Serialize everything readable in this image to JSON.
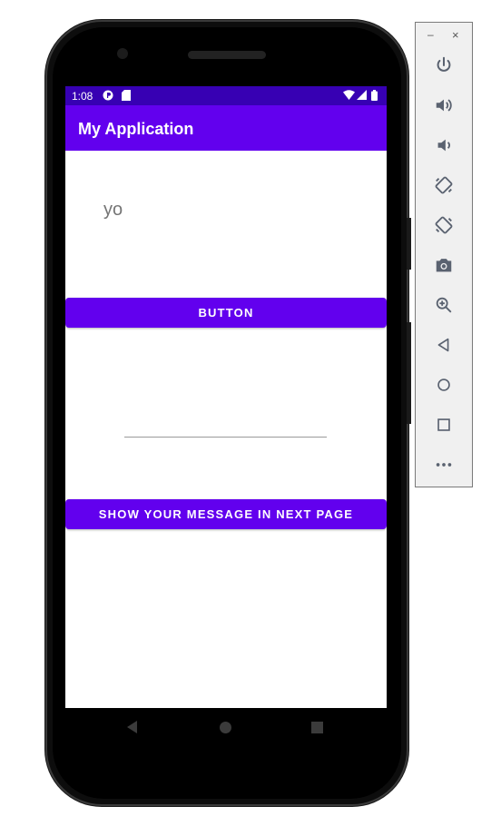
{
  "status_bar": {
    "time": "1:08"
  },
  "app_bar": {
    "title": "My Application"
  },
  "content": {
    "text_view": "yo",
    "button_label": "BUTTON",
    "message_input": {
      "value": "",
      "placeholder": ""
    },
    "show_button_label": "SHOW YOUR MESSAGE IN NEXT PAGE"
  },
  "colors": {
    "primary": "#6200ee",
    "primary_dark": "#3700b3"
  },
  "toolbar": {
    "minimize": "–",
    "close": "×",
    "icons": [
      "power-icon",
      "volume-up-icon",
      "volume-down-icon",
      "rotate-left-icon",
      "rotate-right-icon",
      "camera-icon",
      "zoom-icon",
      "back-icon",
      "home-icon",
      "overview-icon",
      "more-icon"
    ]
  }
}
